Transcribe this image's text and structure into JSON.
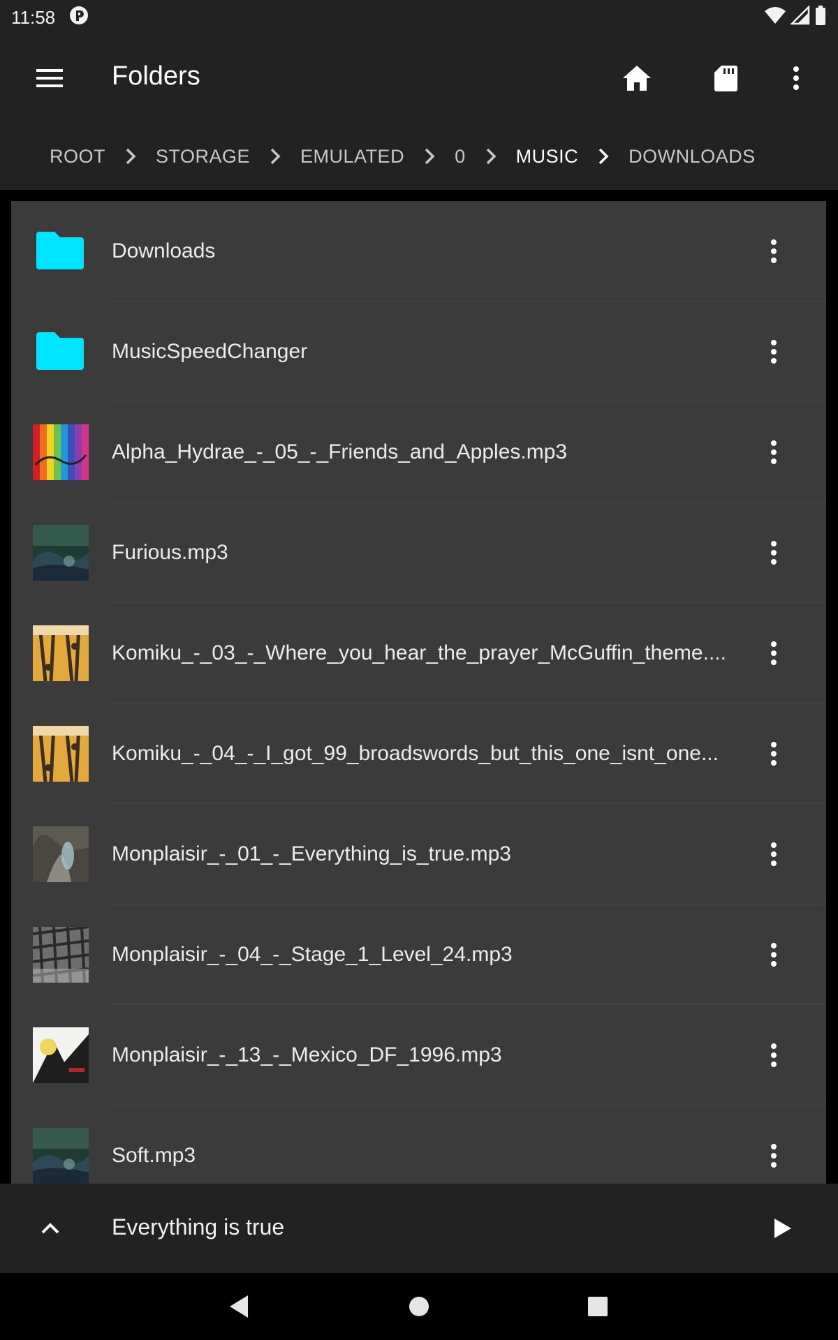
{
  "status_bar": {
    "time": "11:58"
  },
  "toolbar": {
    "title": "Folders"
  },
  "breadcrumb": {
    "items": [
      {
        "label": "ROOT"
      },
      {
        "label": "STORAGE"
      },
      {
        "label": "EMULATED"
      },
      {
        "label": "0"
      },
      {
        "label": "MUSIC"
      },
      {
        "label": "DOWNLOADS"
      }
    ]
  },
  "list": {
    "items": [
      {
        "label": "Downloads",
        "type": "folder"
      },
      {
        "label": "MusicSpeedChanger",
        "type": "folder"
      },
      {
        "label": "Alpha_Hydrae_-_05_-_Friends_and_Apples.mp3",
        "type": "audio"
      },
      {
        "label": "Furious.mp3",
        "type": "audio"
      },
      {
        "label": "Komiku_-_03_-_Where_you_hear_the_prayer_McGuffin_theme....",
        "type": "audio"
      },
      {
        "label": "Komiku_-_04_-_I_got_99_broadswords_but_this_one_isnt_one...",
        "type": "audio"
      },
      {
        "label": "Monplaisir_-_01_-_Everything_is_true.mp3",
        "type": "audio"
      },
      {
        "label": "Monplaisir_-_04_-_Stage_1_Level_24.mp3",
        "type": "audio"
      },
      {
        "label": "Monplaisir_-_13_-_Mexico_DF_1996.mp3",
        "type": "audio"
      },
      {
        "label": "Soft.mp3",
        "type": "audio"
      }
    ]
  },
  "now_playing": {
    "title": "Everything is true"
  },
  "colors": {
    "folder": "#00e5ff",
    "bar": "#222222",
    "list_bg": "#3b3b3b"
  }
}
